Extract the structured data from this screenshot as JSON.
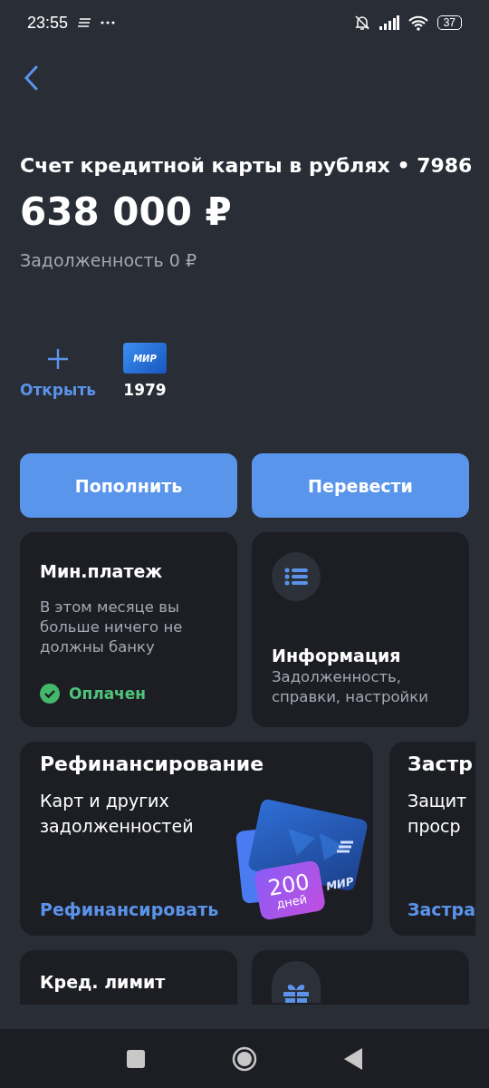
{
  "status_bar": {
    "time": "23:55",
    "battery": "37"
  },
  "account": {
    "title": "Счет кредитной карты в рублях • 7986",
    "balance": "638 000 ₽",
    "debt": "Задолженность 0 ₽"
  },
  "cards_row": [
    {
      "kind": "add",
      "label": "Открыть"
    },
    {
      "kind": "card",
      "brand": "МИР",
      "label": "1979"
    }
  ],
  "actions": [
    "Пополнить",
    "Перевести"
  ],
  "tiles": [
    {
      "kind": "status",
      "title": "Мин.платеж",
      "text": "В этом месяце вы больше ничего не должны банку",
      "status": "Оплачен",
      "paid": true
    },
    {
      "kind": "info",
      "title": "Информация",
      "text": "Задолженность, справки, настройки"
    }
  ],
  "offers": [
    {
      "title": "Рефинансирование",
      "text": "Карт и других задолженностей",
      "link": "Рефинансировать",
      "promo": {
        "number": "200",
        "unit": "дней",
        "brand": "МИР"
      }
    },
    {
      "title": "Застр",
      "text": "Защит\nпроср",
      "link": "Застра"
    }
  ],
  "bottom_tiles": [
    {
      "kind": "text",
      "title": "Кред. лимит"
    },
    {
      "kind": "gift"
    }
  ]
}
